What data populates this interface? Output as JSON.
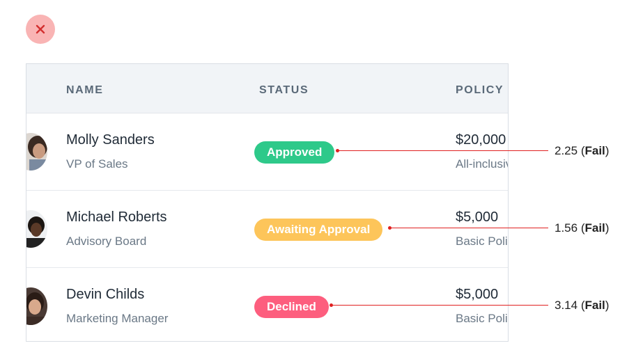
{
  "table": {
    "headers": {
      "name": "NAME",
      "status": "STATUS",
      "policy": "POLICY"
    },
    "rows": [
      {
        "name": "Molly Sanders",
        "role": "VP of Sales",
        "status": "Approved",
        "amount": "$20,000",
        "plan": "All-inclusive Policy",
        "contrast_ratio": "2.25",
        "contrast_result": "Fail"
      },
      {
        "name": "Michael Roberts",
        "role": "Advisory Board",
        "status": "Awaiting Approval",
        "amount": "$5,000",
        "plan": "Basic Policy",
        "contrast_ratio": "1.56",
        "contrast_result": "Fail"
      },
      {
        "name": "Devin Childs",
        "role": "Marketing Manager",
        "status": "Declined",
        "amount": "$5,000",
        "plan": "Basic Policy",
        "contrast_ratio": "3.14",
        "contrast_result": "Fail"
      }
    ]
  },
  "colors": {
    "approved": "#2ec98a",
    "awaiting": "#fdc55a",
    "declined": "#fd5e7e",
    "annotation": "#e02020",
    "close_bg": "#f9b4b4"
  },
  "icons": {
    "close": "close-icon",
    "avatar": "avatar"
  }
}
